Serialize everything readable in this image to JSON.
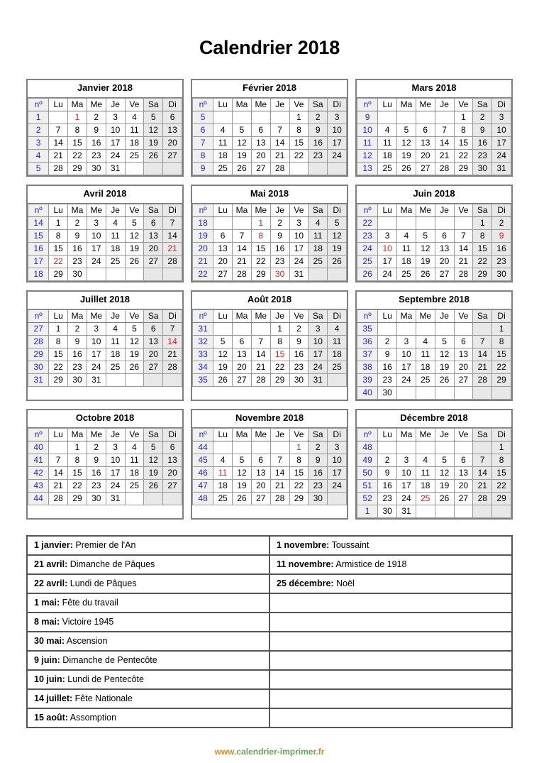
{
  "title": "Calendrier 2018",
  "colors": {
    "week_number": "#2222dd",
    "holiday": "#e01b1b",
    "weekend_bg": "#e8e8e8",
    "week_col_bg": "#f0f0f0",
    "border": "#808080",
    "url_orange": "#d98a2b",
    "url_green": "#6aa84f"
  },
  "weekday_headers": [
    "nº",
    "Lu",
    "Ma",
    "Me",
    "Je",
    "Ve",
    "Sa",
    "Di"
  ],
  "months": [
    {
      "name": "Janvier 2018",
      "weeks": [
        {
          "no": "1",
          "days": [
            "",
            "1",
            "2",
            "3",
            "4",
            "5",
            "6"
          ],
          "holidays": [
            1
          ]
        },
        {
          "no": "2",
          "days": [
            "7",
            "8",
            "9",
            "10",
            "11",
            "12",
            "13"
          ],
          "holidays": []
        },
        {
          "no": "3",
          "days": [
            "14",
            "15",
            "16",
            "17",
            "18",
            "19",
            "20"
          ],
          "holidays": []
        },
        {
          "no": "4",
          "days": [
            "21",
            "22",
            "23",
            "24",
            "25",
            "26",
            "27"
          ],
          "holidays": []
        },
        {
          "no": "5",
          "days": [
            "28",
            "29",
            "30",
            "31",
            "",
            "",
            ""
          ],
          "holidays": []
        }
      ]
    },
    {
      "name": "Février 2018",
      "weeks": [
        {
          "no": "5",
          "days": [
            "",
            "",
            "",
            "",
            "1",
            "2",
            "3"
          ],
          "holidays": []
        },
        {
          "no": "6",
          "days": [
            "4",
            "5",
            "6",
            "7",
            "8",
            "9",
            "10"
          ],
          "holidays": []
        },
        {
          "no": "7",
          "days": [
            "11",
            "12",
            "13",
            "14",
            "15",
            "16",
            "17"
          ],
          "holidays": []
        },
        {
          "no": "8",
          "days": [
            "18",
            "19",
            "20",
            "21",
            "22",
            "23",
            "24"
          ],
          "holidays": []
        },
        {
          "no": "9",
          "days": [
            "25",
            "26",
            "27",
            "28",
            "",
            "",
            ""
          ],
          "holidays": []
        }
      ]
    },
    {
      "name": "Mars 2018",
      "weeks": [
        {
          "no": "9",
          "days": [
            "",
            "",
            "",
            "",
            "1",
            "2",
            "3"
          ],
          "holidays": []
        },
        {
          "no": "10",
          "days": [
            "4",
            "5",
            "6",
            "7",
            "8",
            "9",
            "10"
          ],
          "holidays": []
        },
        {
          "no": "11",
          "days": [
            "11",
            "12",
            "13",
            "14",
            "15",
            "16",
            "17"
          ],
          "holidays": []
        },
        {
          "no": "12",
          "days": [
            "18",
            "19",
            "20",
            "21",
            "22",
            "23",
            "24"
          ],
          "holidays": []
        },
        {
          "no": "13",
          "days": [
            "25",
            "26",
            "27",
            "28",
            "29",
            "30",
            "31"
          ],
          "holidays": []
        }
      ]
    },
    {
      "name": "Avril 2018",
      "weeks": [
        {
          "no": "14",
          "days": [
            "1",
            "2",
            "3",
            "4",
            "5",
            "6",
            "7"
          ],
          "holidays": []
        },
        {
          "no": "15",
          "days": [
            "8",
            "9",
            "10",
            "11",
            "12",
            "13",
            "14"
          ],
          "holidays": []
        },
        {
          "no": "16",
          "days": [
            "15",
            "16",
            "17",
            "18",
            "19",
            "20",
            "21"
          ],
          "holidays": [
            6
          ]
        },
        {
          "no": "17",
          "days": [
            "22",
            "23",
            "24",
            "25",
            "26",
            "27",
            "28"
          ],
          "holidays": [
            0
          ]
        },
        {
          "no": "18",
          "days": [
            "29",
            "30",
            "",
            "",
            "",
            "",
            ""
          ],
          "holidays": []
        }
      ]
    },
    {
      "name": "Mai 2018",
      "weeks": [
        {
          "no": "18",
          "days": [
            "",
            "",
            "1",
            "2",
            "3",
            "4",
            "5"
          ],
          "holidays": [
            2
          ]
        },
        {
          "no": "19",
          "days": [
            "6",
            "7",
            "8",
            "9",
            "10",
            "11",
            "12"
          ],
          "holidays": [
            2
          ]
        },
        {
          "no": "20",
          "days": [
            "13",
            "14",
            "15",
            "16",
            "17",
            "18",
            "19"
          ],
          "holidays": []
        },
        {
          "no": "21",
          "days": [
            "20",
            "21",
            "22",
            "23",
            "24",
            "25",
            "26"
          ],
          "holidays": []
        },
        {
          "no": "22",
          "days": [
            "27",
            "28",
            "29",
            "30",
            "31",
            "",
            ""
          ],
          "holidays": [
            3
          ]
        }
      ]
    },
    {
      "name": "Juin 2018",
      "weeks": [
        {
          "no": "22",
          "days": [
            "",
            "",
            "",
            "",
            "",
            "1",
            "2"
          ],
          "holidays": []
        },
        {
          "no": "23",
          "days": [
            "3",
            "4",
            "5",
            "6",
            "7",
            "8",
            "9"
          ],
          "holidays": [
            6
          ]
        },
        {
          "no": "24",
          "days": [
            "10",
            "11",
            "12",
            "13",
            "14",
            "15",
            "16"
          ],
          "holidays": [
            0
          ]
        },
        {
          "no": "25",
          "days": [
            "17",
            "18",
            "19",
            "20",
            "21",
            "22",
            "23"
          ],
          "holidays": []
        },
        {
          "no": "26",
          "days": [
            "24",
            "25",
            "26",
            "27",
            "28",
            "29",
            "30"
          ],
          "holidays": []
        }
      ]
    },
    {
      "name": "Juillet 2018",
      "weeks": [
        {
          "no": "27",
          "days": [
            "1",
            "2",
            "3",
            "4",
            "5",
            "6",
            "7"
          ],
          "holidays": []
        },
        {
          "no": "28",
          "days": [
            "8",
            "9",
            "10",
            "11",
            "12",
            "13",
            "14"
          ],
          "holidays": [
            6
          ]
        },
        {
          "no": "29",
          "days": [
            "15",
            "16",
            "17",
            "18",
            "19",
            "20",
            "21"
          ],
          "holidays": []
        },
        {
          "no": "30",
          "days": [
            "22",
            "23",
            "24",
            "25",
            "26",
            "27",
            "28"
          ],
          "holidays": []
        },
        {
          "no": "31",
          "days": [
            "29",
            "30",
            "31",
            "",
            "",
            "",
            ""
          ],
          "holidays": []
        }
      ]
    },
    {
      "name": "Août 2018",
      "weeks": [
        {
          "no": "31",
          "days": [
            "",
            "",
            "",
            "1",
            "2",
            "3",
            "4"
          ],
          "holidays": []
        },
        {
          "no": "32",
          "days": [
            "5",
            "6",
            "7",
            "8",
            "9",
            "10",
            "11"
          ],
          "holidays": []
        },
        {
          "no": "33",
          "days": [
            "12",
            "13",
            "14",
            "15",
            "16",
            "17",
            "18"
          ],
          "holidays": [
            3
          ]
        },
        {
          "no": "34",
          "days": [
            "19",
            "20",
            "21",
            "22",
            "23",
            "24",
            "25"
          ],
          "holidays": []
        },
        {
          "no": "35",
          "days": [
            "26",
            "27",
            "28",
            "29",
            "30",
            "31",
            ""
          ],
          "holidays": []
        }
      ]
    },
    {
      "name": "Septembre 2018",
      "weeks": [
        {
          "no": "35",
          "days": [
            "",
            "",
            "",
            "",
            "",
            "",
            "1"
          ],
          "holidays": []
        },
        {
          "no": "36",
          "days": [
            "2",
            "3",
            "4",
            "5",
            "6",
            "7",
            "8"
          ],
          "holidays": []
        },
        {
          "no": "37",
          "days": [
            "9",
            "10",
            "11",
            "12",
            "13",
            "14",
            "15"
          ],
          "holidays": []
        },
        {
          "no": "38",
          "days": [
            "16",
            "17",
            "18",
            "19",
            "20",
            "21",
            "22"
          ],
          "holidays": []
        },
        {
          "no": "39",
          "days": [
            "23",
            "24",
            "25",
            "26",
            "27",
            "28",
            "29"
          ],
          "holidays": []
        },
        {
          "no": "40",
          "days": [
            "30",
            "",
            "",
            "",
            "",
            "",
            ""
          ],
          "holidays": []
        }
      ]
    },
    {
      "name": "Octobre 2018",
      "weeks": [
        {
          "no": "40",
          "days": [
            "",
            "1",
            "2",
            "3",
            "4",
            "5",
            "6"
          ],
          "holidays": []
        },
        {
          "no": "41",
          "days": [
            "7",
            "8",
            "9",
            "10",
            "11",
            "12",
            "13"
          ],
          "holidays": []
        },
        {
          "no": "42",
          "days": [
            "14",
            "15",
            "16",
            "17",
            "18",
            "19",
            "20"
          ],
          "holidays": []
        },
        {
          "no": "43",
          "days": [
            "21",
            "22",
            "23",
            "24",
            "25",
            "26",
            "27"
          ],
          "holidays": []
        },
        {
          "no": "44",
          "days": [
            "28",
            "29",
            "30",
            "31",
            "",
            "",
            ""
          ],
          "holidays": []
        }
      ]
    },
    {
      "name": "Novembre 2018",
      "weeks": [
        {
          "no": "44",
          "days": [
            "",
            "",
            "",
            "",
            "1",
            "2",
            "3"
          ],
          "holidays": [
            4
          ]
        },
        {
          "no": "45",
          "days": [
            "4",
            "5",
            "6",
            "7",
            "8",
            "9",
            "10"
          ],
          "holidays": []
        },
        {
          "no": "46",
          "days": [
            "11",
            "12",
            "13",
            "14",
            "15",
            "16",
            "17"
          ],
          "holidays": [
            0
          ]
        },
        {
          "no": "47",
          "days": [
            "18",
            "19",
            "20",
            "21",
            "22",
            "23",
            "24"
          ],
          "holidays": []
        },
        {
          "no": "48",
          "days": [
            "25",
            "26",
            "27",
            "28",
            "29",
            "30",
            ""
          ],
          "holidays": []
        }
      ]
    },
    {
      "name": "Décembre 2018",
      "weeks": [
        {
          "no": "48",
          "days": [
            "",
            "",
            "",
            "",
            "",
            "",
            "1"
          ],
          "holidays": []
        },
        {
          "no": "49",
          "days": [
            "2",
            "3",
            "4",
            "5",
            "6",
            "7",
            "8"
          ],
          "holidays": []
        },
        {
          "no": "50",
          "days": [
            "9",
            "10",
            "11",
            "12",
            "13",
            "14",
            "15"
          ],
          "holidays": []
        },
        {
          "no": "51",
          "days": [
            "16",
            "17",
            "18",
            "19",
            "20",
            "21",
            "22"
          ],
          "holidays": []
        },
        {
          "no": "52",
          "days": [
            "23",
            "24",
            "25",
            "26",
            "27",
            "28",
            "29"
          ],
          "holidays": [
            2
          ]
        },
        {
          "no": "1",
          "days": [
            "30",
            "31",
            "",
            "",
            "",
            "",
            ""
          ],
          "holidays": []
        }
      ]
    }
  ],
  "holidays_table": {
    "left": [
      {
        "date": "1 janvier:",
        "label": "Premier de l'An"
      },
      {
        "date": "21 avril:",
        "label": "Dimanche de Pâques"
      },
      {
        "date": "22 avril:",
        "label": "Lundi de Pâques"
      },
      {
        "date": "1 mai:",
        "label": "Fête du travail"
      },
      {
        "date": "8 mai:",
        "label": "Victoire 1945"
      },
      {
        "date": "30 mai:",
        "label": "Ascension"
      },
      {
        "date": "9 juin:",
        "label": "Dimanche de Pentecôte"
      },
      {
        "date": "10 juin:",
        "label": "Lundi de Pentecôte"
      },
      {
        "date": "14 juillet:",
        "label": "Fête Nationale"
      },
      {
        "date": "15 août:",
        "label": "Assomption"
      }
    ],
    "right": [
      {
        "date": "1 novembre:",
        "label": "Toussaint"
      },
      {
        "date": "11 novembre:",
        "label": "Armistice de 1918"
      },
      {
        "date": "25 décembre:",
        "label": "Noël"
      },
      {
        "date": "",
        "label": ""
      },
      {
        "date": "",
        "label": ""
      },
      {
        "date": "",
        "label": ""
      },
      {
        "date": "",
        "label": ""
      },
      {
        "date": "",
        "label": ""
      },
      {
        "date": "",
        "label": ""
      },
      {
        "date": "",
        "label": ""
      }
    ]
  },
  "footer": {
    "url_part1": "www.",
    "url_part2": "calendrier-imprimer",
    "url_part3": ".fr"
  }
}
